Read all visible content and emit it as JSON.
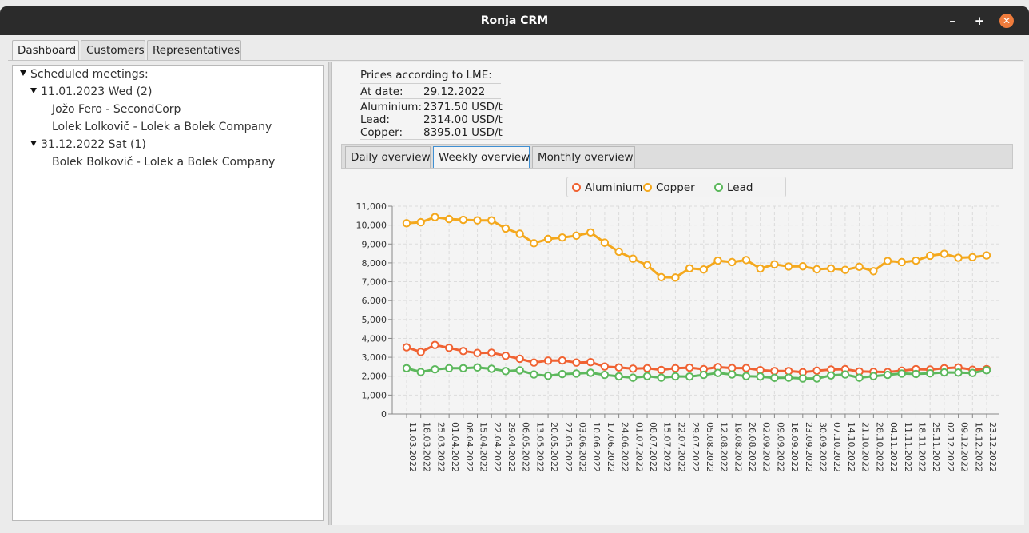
{
  "window": {
    "title": "Ronja CRM",
    "minimize": "–",
    "maximize": "+",
    "close": "✕"
  },
  "tabs": [
    "Dashboard",
    "Customers",
    "Representatives"
  ],
  "tree": {
    "root": "Scheduled meetings:",
    "groups": [
      {
        "label": "11.01.2023 Wed (2)",
        "items": [
          "Jožo Fero - SecondCorp",
          "Lolek Lolkovič - Lolek a Bolek Company"
        ]
      },
      {
        "label": "31.12.2022 Sat (1)",
        "items": [
          "Bolek Bolkovič - Lolek a Bolek Company"
        ]
      }
    ]
  },
  "lme": {
    "heading": "Prices according to LME:",
    "date_label": "At date:",
    "date_value": "29.12.2022",
    "aluminium_label": "Aluminium:",
    "aluminium_value": "2371.50 USD/t",
    "lead_label": "Lead:",
    "lead_value": "2314.00 USD/t",
    "copper_label": "Copper:",
    "copper_value": "8395.01 USD/t"
  },
  "chart_tabs": [
    "Daily overview",
    "Weekly overview",
    "Monthly overview"
  ],
  "colors": {
    "aluminium": "#f06232",
    "copper": "#f4a81d",
    "lead": "#5cb85c"
  },
  "chart_data": {
    "type": "line",
    "legend_position": "top",
    "grid": true,
    "ylim": [
      0,
      11000
    ],
    "yticks": [
      "0",
      "1,000",
      "2,000",
      "3,000",
      "4,000",
      "5,000",
      "6,000",
      "7,000",
      "8,000",
      "9,000",
      "10,000",
      "11,000"
    ],
    "categories": [
      "11.03.2022",
      "18.03.2022",
      "25.03.2022",
      "01.04.2022",
      "08.04.2022",
      "15.04.2022",
      "22.04.2022",
      "29.04.2022",
      "06.05.2022",
      "13.05.2022",
      "20.05.2022",
      "27.05.2022",
      "03.06.2022",
      "10.06.2022",
      "17.06.2022",
      "24.06.2022",
      "01.07.2022",
      "08.07.2022",
      "15.07.2022",
      "22.07.2022",
      "29.07.2022",
      "05.08.2022",
      "12.08.2022",
      "19.08.2022",
      "26.08.2022",
      "02.09.2022",
      "09.09.2022",
      "16.09.2022",
      "23.09.2022",
      "30.09.2022",
      "07.10.2022",
      "14.10.2022",
      "21.10.2022",
      "28.10.2022",
      "04.11.2022",
      "11.11.2022",
      "18.11.2022",
      "25.11.2022",
      "02.12.2022",
      "09.12.2022",
      "16.12.2022",
      "23.12.2022"
    ],
    "series": [
      {
        "name": "Aluminium",
        "values": [
          3530,
          3280,
          3650,
          3500,
          3330,
          3230,
          3240,
          3080,
          2920,
          2720,
          2820,
          2830,
          2720,
          2740,
          2510,
          2460,
          2400,
          2420,
          2330,
          2420,
          2450,
          2370,
          2480,
          2430,
          2430,
          2320,
          2270,
          2270,
          2210,
          2290,
          2350,
          2370,
          2250,
          2230,
          2220,
          2290,
          2370,
          2350,
          2420,
          2460,
          2340,
          2371
        ]
      },
      {
        "name": "Copper",
        "values": [
          10100,
          10150,
          10420,
          10320,
          10280,
          10250,
          10250,
          9820,
          9540,
          9040,
          9270,
          9340,
          9440,
          9610,
          9070,
          8590,
          8220,
          7880,
          7240,
          7220,
          7710,
          7650,
          8120,
          8040,
          8150,
          7700,
          7920,
          7810,
          7820,
          7660,
          7700,
          7630,
          7790,
          7560,
          8100,
          8040,
          8120,
          8380,
          8480,
          8270,
          8300,
          8395
        ]
      },
      {
        "name": "Lead",
        "values": [
          2420,
          2220,
          2360,
          2420,
          2420,
          2460,
          2390,
          2270,
          2310,
          2090,
          2020,
          2110,
          2140,
          2180,
          2070,
          1990,
          1920,
          2000,
          1920,
          1990,
          1980,
          2070,
          2170,
          2090,
          2000,
          1980,
          1910,
          1920,
          1880,
          1880,
          2040,
          2090,
          1920,
          2000,
          2070,
          2140,
          2120,
          2150,
          2200,
          2190,
          2170,
          2314
        ]
      }
    ]
  }
}
